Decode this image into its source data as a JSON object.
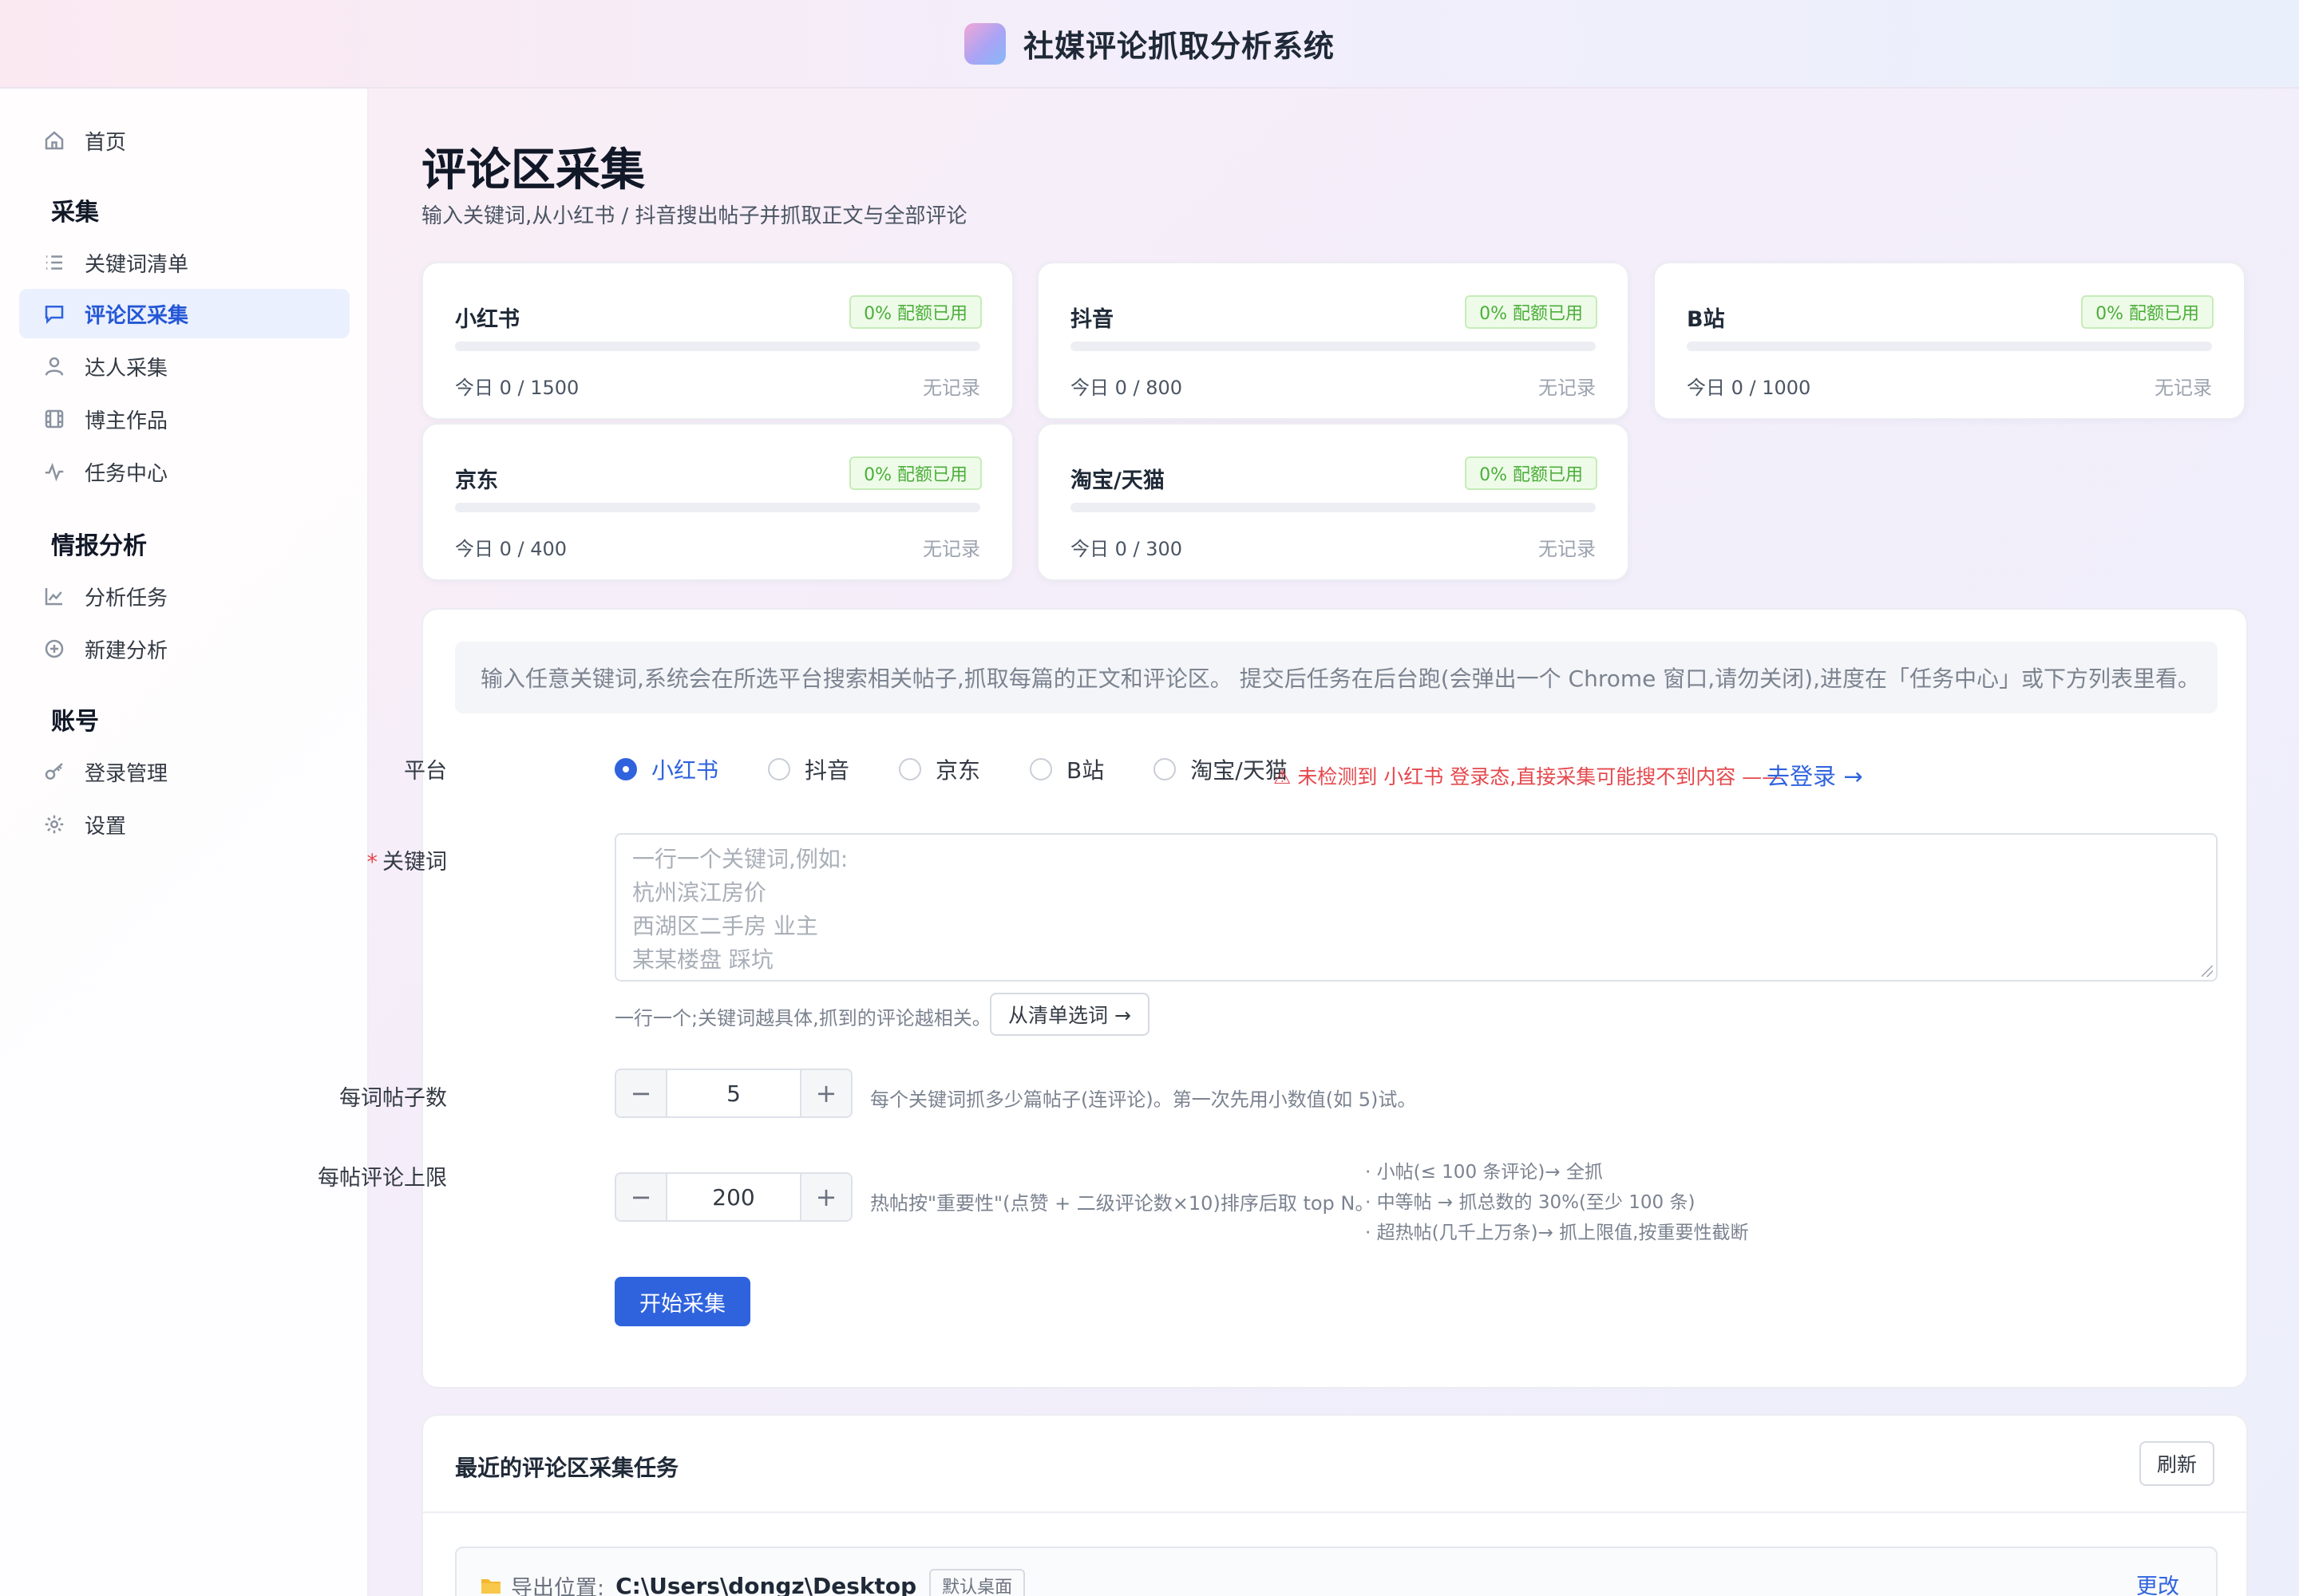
{
  "header": {
    "title": "社媒评论抓取分析系统"
  },
  "sidebar": {
    "home": "首页",
    "groups": {
      "collect": "采集",
      "analysis": "情报分析",
      "account": "账号"
    },
    "items": {
      "keywords": "关键词清单",
      "comments": "评论区采集",
      "creators": "达人采集",
      "works": "博主作品",
      "tasks": "任务中心",
      "analysis_tasks": "分析任务",
      "new_analysis": "新建分析",
      "login": "登录管理",
      "settings": "设置"
    }
  },
  "page": {
    "title": "评论区采集",
    "subtitle": "输入关键词,从小红书 / 抖音搜出帖子并抓取正文与全部评论"
  },
  "quotas": [
    {
      "name": "小红书",
      "badge": "0% 配额已用",
      "used_fraction": 0,
      "today": "今日 0 / 1500",
      "record": "无记录"
    },
    {
      "name": "抖音",
      "badge": "0% 配额已用",
      "used_fraction": 0,
      "today": "今日 0 / 800",
      "record": "无记录"
    },
    {
      "name": "B站",
      "badge": "0% 配额已用",
      "used_fraction": 0,
      "today": "今日 0 / 1000",
      "record": "无记录"
    },
    {
      "name": "京东",
      "badge": "0% 配额已用",
      "used_fraction": 0,
      "today": "今日 0 / 400",
      "record": "无记录"
    },
    {
      "name": "淘宝/天猫",
      "badge": "0% 配额已用",
      "used_fraction": 0,
      "today": "今日 0 / 300",
      "record": "无记录"
    }
  ],
  "form": {
    "notice": "输入任意关键词,系统会在所选平台搜索相关帖子,抓取每篇的正文和评论区。 提交后任务在后台跑(会弹出一个 Chrome 窗口,请勿关闭),进度在「任务中心」或下方列表里看。",
    "platform_label": "平台",
    "platforms": [
      "小红书",
      "抖音",
      "京东",
      "B站",
      "淘宝/天猫"
    ],
    "selected_platform": "小红书",
    "login_warning": "⚠ 未检测到 小红书 登录态,直接采集可能搜不到内容 ——",
    "login_link": "去登录 →",
    "keyword_required_mark": "*",
    "keyword_label": "关键词",
    "keyword_placeholder_lines": [
      "一行一个关键词,例如:",
      "杭州滨江房价",
      "西湖区二手房 业主",
      "某某楼盘 踩坑"
    ],
    "keyword_hint": "一行一个;关键词越具体,抓到的评论越相关。",
    "pick_from_list": "从清单选词 →",
    "posts_label": "每词帖子数",
    "posts_value": "5",
    "posts_hint": "每个关键词抓多少篇帖子(连评论)。第一次先用小数值(如 5)试。",
    "comments_label": "每帖评论上限",
    "comments_value": "200",
    "comments_hint": "热帖按\"重要性\"(点赞 + 二级评论数×10)排序后取 top N。",
    "rules": [
      "· 小帖(≤ 100 条评论)→ 全抓",
      "· 中等帖 → 抓总数的 30%(至少 100 条)",
      "· 超热帖(几千上万条)→ 抓上限值,按重要性截断"
    ],
    "minus": "−",
    "plus": "+",
    "submit": "开始采集"
  },
  "recent": {
    "title": "最近的评论区采集任务",
    "refresh": "刷新",
    "export_label": "导出位置:",
    "export_path": "C:\\Users\\dongz\\Desktop",
    "export_tag": "默认桌面",
    "change": "更改"
  },
  "colors": {
    "primary": "#2f63de",
    "danger": "#e5484d",
    "success": "#4cae3a"
  },
  "icons": {
    "home": "home-icon",
    "keywords": "list-icon",
    "comments": "chat-bubble-icon",
    "creators": "user-icon",
    "works": "film-icon",
    "tasks": "activity-icon",
    "analysis_tasks": "line-chart-icon",
    "new_analysis": "plus-circle-icon",
    "login": "key-icon",
    "settings": "gear-icon"
  }
}
